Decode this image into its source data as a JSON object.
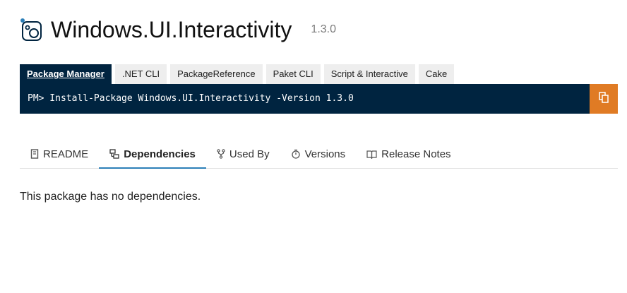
{
  "package": {
    "name": "Windows.UI.Interactivity",
    "version": "1.3.0",
    "logo_icon": "package-icon"
  },
  "install_tabs": [
    {
      "label": "Package Manager",
      "active": true
    },
    {
      "label": ".NET CLI",
      "active": false
    },
    {
      "label": "PackageReference",
      "active": false
    },
    {
      "label": "Paket CLI",
      "active": false
    },
    {
      "label": "Script & Interactive",
      "active": false
    },
    {
      "label": "Cake",
      "active": false
    }
  ],
  "command": {
    "text": "PM> Install-Package Windows.UI.Interactivity -Version 1.3.0",
    "copy_icon": "copy-icon"
  },
  "body_tabs": [
    {
      "label": "README",
      "icon": "readme-icon",
      "active": false
    },
    {
      "label": "Dependencies",
      "icon": "dependencies-icon",
      "active": true
    },
    {
      "label": "Used By",
      "icon": "used-by-icon",
      "active": false
    },
    {
      "label": "Versions",
      "icon": "versions-icon",
      "active": false
    },
    {
      "label": "Release Notes",
      "icon": "release-notes-icon",
      "active": false
    }
  ],
  "content": {
    "message": "This package has no dependencies."
  },
  "colors": {
    "command_bg": "#002440",
    "copy_button": "#e07b24",
    "active_tab_underline": "#2c7fb8",
    "logo_accent": "#2c7fb8"
  }
}
